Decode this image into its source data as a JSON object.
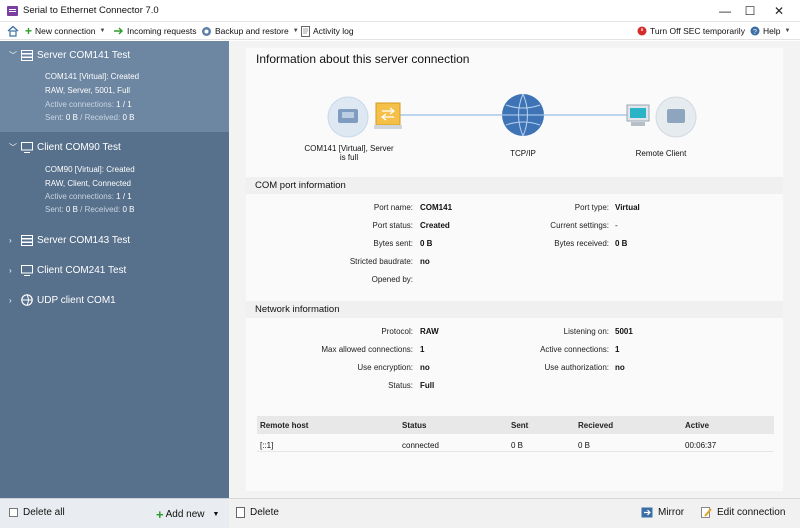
{
  "window": {
    "title": "Serial to Ethernet Connector 7.0",
    "minimize": "—",
    "maximize": "☐",
    "close": "✕"
  },
  "toolbar": {
    "new_connection": "New connection",
    "incoming_requests": "Incoming requests",
    "backup_restore": "Backup and restore",
    "activity_log": "Activity log",
    "turn_off_sec": "Turn Off SEC temporarily",
    "help": "Help"
  },
  "sidebar": {
    "items": [
      {
        "title": "Server COM141 Test",
        "details": [
          "COM141 [Virtual]: Created",
          "RAW, Server, 5001, Full"
        ],
        "active_label": "Active connections:",
        "active_value": "1 / 1",
        "sent_label": "Sent:",
        "sent_value": "0 B",
        "recv_label": "Received:",
        "recv_value": "0 B"
      },
      {
        "title": "Client COM90 Test",
        "details": [
          "COM90 [Virtual]: Created",
          "RAW, Client, Connected"
        ],
        "active_label": "Active connections:",
        "active_value": "1 / 1",
        "sent_label": "Sent:",
        "sent_value": "0 B",
        "recv_label": "Received:",
        "recv_value": "0 B"
      },
      {
        "title": "Server COM143 Test"
      },
      {
        "title": "Client COM241 Test"
      },
      {
        "title": "UDP client COM1"
      }
    ]
  },
  "bottom": {
    "delete_all": "Delete all",
    "add_new": "Add new",
    "delete": "Delete",
    "mirror": "Mirror",
    "edit_connection": "Edit connection"
  },
  "main": {
    "heading": "Information about this server connection",
    "topology": {
      "local": "COM141 [Virtual], Server is full",
      "network": "TCP/IP",
      "remote": "Remote Client"
    },
    "com_section": {
      "title": "COM port information",
      "port_name_label": "Port name:",
      "port_name": "COM141",
      "port_type_label": "Port type:",
      "port_type": "Virtual",
      "port_status_label": "Port status:",
      "port_status": "Created",
      "current_settings_label": "Current settings:",
      "current_settings": "-",
      "bytes_sent_label": "Bytes sent:",
      "bytes_sent": "0 B",
      "bytes_received_label": "Bytes received:",
      "bytes_received": "0 B",
      "stricted_baudrate_label": "Stricted baudrate:",
      "stricted_baudrate": "no",
      "opened_by_label": "Opened by:",
      "opened_by": ""
    },
    "net_section": {
      "title": "Network information",
      "protocol_label": "Protocol:",
      "protocol": "RAW",
      "listening_on_label": "Listening on:",
      "listening_on": "5001",
      "max_allowed_label": "Max allowed connections:",
      "max_allowed": "1",
      "active_connections_label": "Active connections:",
      "active_connections": "1",
      "use_encryption_label": "Use encryption:",
      "use_encryption": "no",
      "use_authorization_label": "Use authorization:",
      "use_authorization": "no",
      "status_label": "Status:",
      "status": "Full"
    },
    "table": {
      "headers": [
        "Remote host",
        "Status",
        "Sent",
        "Recieved",
        "Active"
      ],
      "rows": [
        [
          "[::1]",
          "connected",
          "0 B",
          "0 B",
          "00:06:37"
        ]
      ]
    }
  }
}
